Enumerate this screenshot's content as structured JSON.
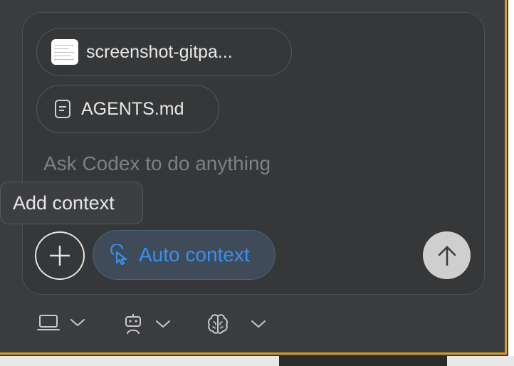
{
  "attachments": [
    {
      "name": "screenshot-gitpa...",
      "icon": "image-thumbnail-icon"
    },
    {
      "name": "AGENTS.md",
      "icon": "document-icon"
    }
  ],
  "composer": {
    "placeholder": "Ask Codex to do anything"
  },
  "tooltip": {
    "text": "Add context"
  },
  "buttons": {
    "add_icon": "plus-icon",
    "auto_context_label": "Auto context",
    "auto_context_icon": "pointer-click-icon",
    "send_icon": "arrow-up-icon"
  },
  "toolbar": [
    {
      "icon": "laptop-icon",
      "dropdown": "chevron-down-icon"
    },
    {
      "icon": "robot-icon",
      "dropdown": "chevron-down-icon"
    },
    {
      "icon": "brain-icon",
      "dropdown": "chevron-down-icon"
    }
  ],
  "colors": {
    "background": "#3a3c3f",
    "composer": "#353739",
    "accent_blue": "#3a8ff0",
    "window_border": "#d49a2a",
    "send_button": "#cfcfcf"
  }
}
